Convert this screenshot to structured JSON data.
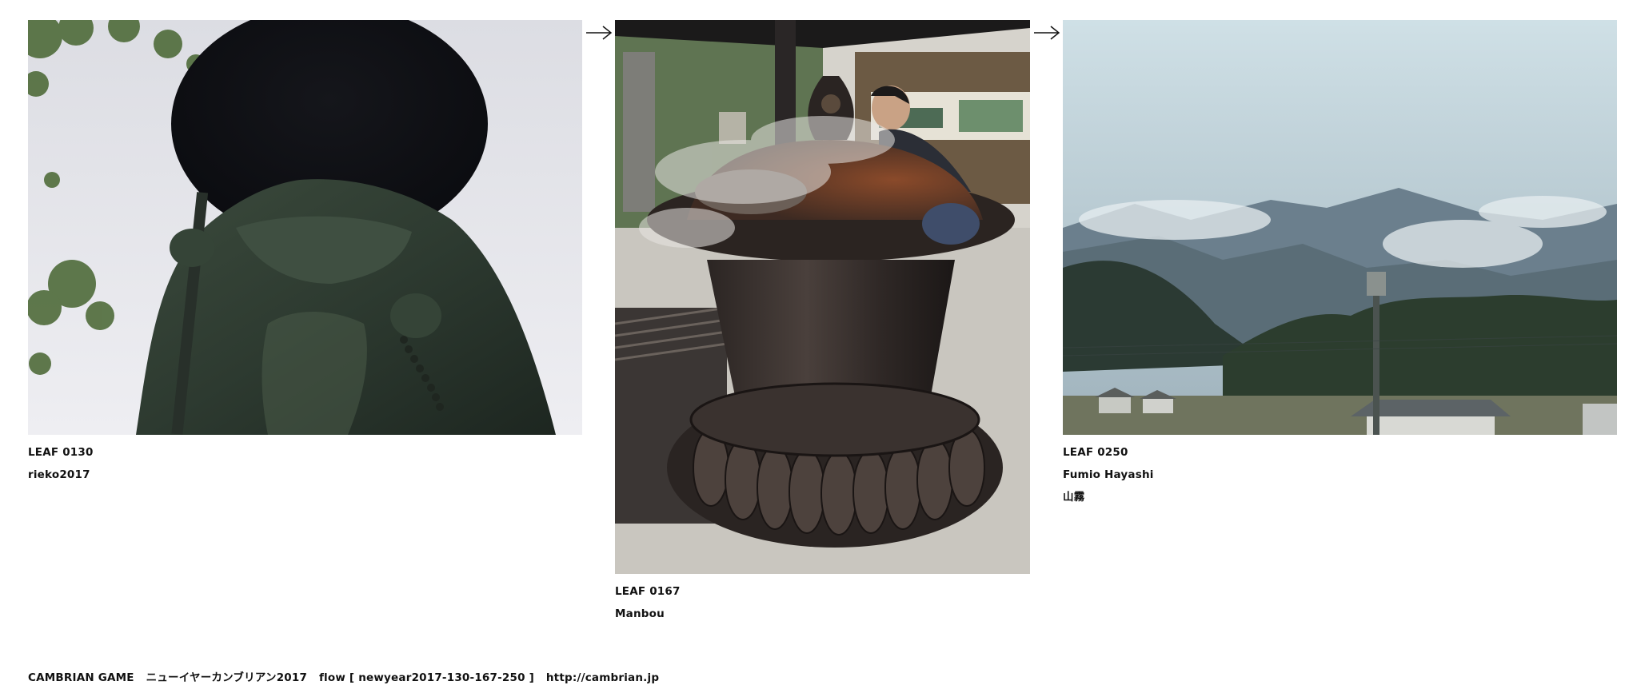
{
  "leaves": [
    {
      "label": "LEAF 0130",
      "author": "rieko2017",
      "image": "photo-jizo-statue-straw-hat"
    },
    {
      "label": "LEAF 0167",
      "author": "Manbou",
      "image": "photo-temple-incense-burner"
    },
    {
      "label": "LEAF 0250",
      "author": "Fumio Hayashi",
      "title": "山霧",
      "image": "photo-misty-mountains"
    }
  ],
  "arrows": [
    "arrow-right-icon",
    "arrow-right-icon"
  ],
  "footer": {
    "site": "CAMBRIAN GAME",
    "event": "ニューイヤーカンブリアン2017",
    "flow": "flow [ newyear2017-130-167-250 ]",
    "url": "http://cambrian.jp"
  }
}
